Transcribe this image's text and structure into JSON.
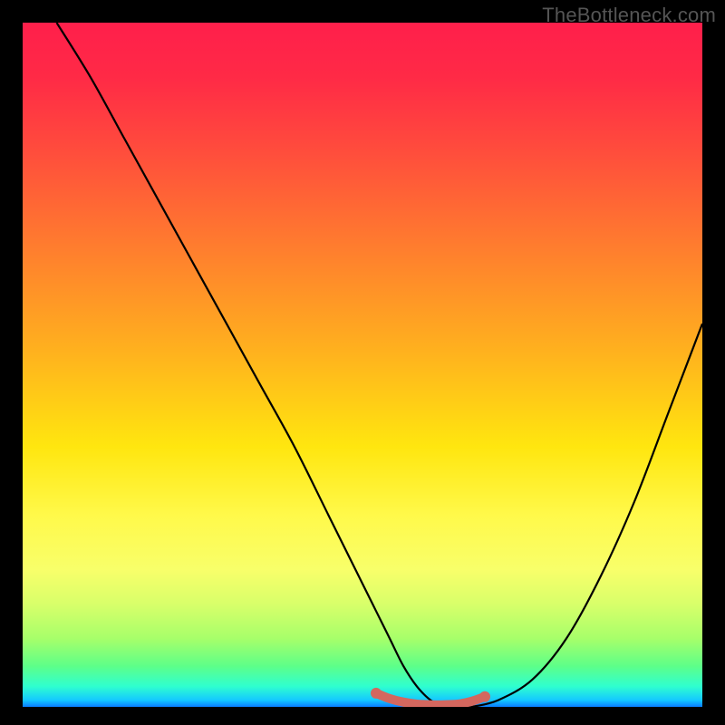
{
  "watermark": "TheBottleneck.com",
  "chart_data": {
    "type": "line",
    "title": "",
    "xlabel": "",
    "ylabel": "",
    "xlim": [
      0,
      100
    ],
    "ylim": [
      0,
      100
    ],
    "grid": false,
    "legend": false,
    "series": [
      {
        "name": "curve",
        "x": [
          5,
          10,
          15,
          20,
          25,
          30,
          35,
          40,
          45,
          50,
          52,
          54,
          56,
          58,
          60,
          62,
          64,
          66,
          70,
          75,
          80,
          85,
          90,
          95,
          100
        ],
        "y": [
          100,
          92,
          83,
          74,
          65,
          56,
          47,
          38,
          28,
          18,
          14,
          10,
          6,
          3,
          1,
          0,
          0,
          0,
          1,
          4,
          10,
          19,
          30,
          43,
          56
        ]
      },
      {
        "name": "flat-bottom-marker",
        "x": [
          52,
          54,
          56,
          58,
          60,
          62,
          64,
          66,
          68
        ],
        "y": [
          2,
          1.2,
          0.7,
          0.4,
          0.3,
          0.3,
          0.4,
          0.8,
          1.5
        ]
      }
    ],
    "annotations": [],
    "colors": {
      "curve": "#000000",
      "marker": "#d3675e",
      "gradient_top": "#ff1f4b",
      "gradient_mid": "#ffe60f",
      "gradient_bottom": "#14c9ff",
      "frame": "#000000"
    }
  }
}
